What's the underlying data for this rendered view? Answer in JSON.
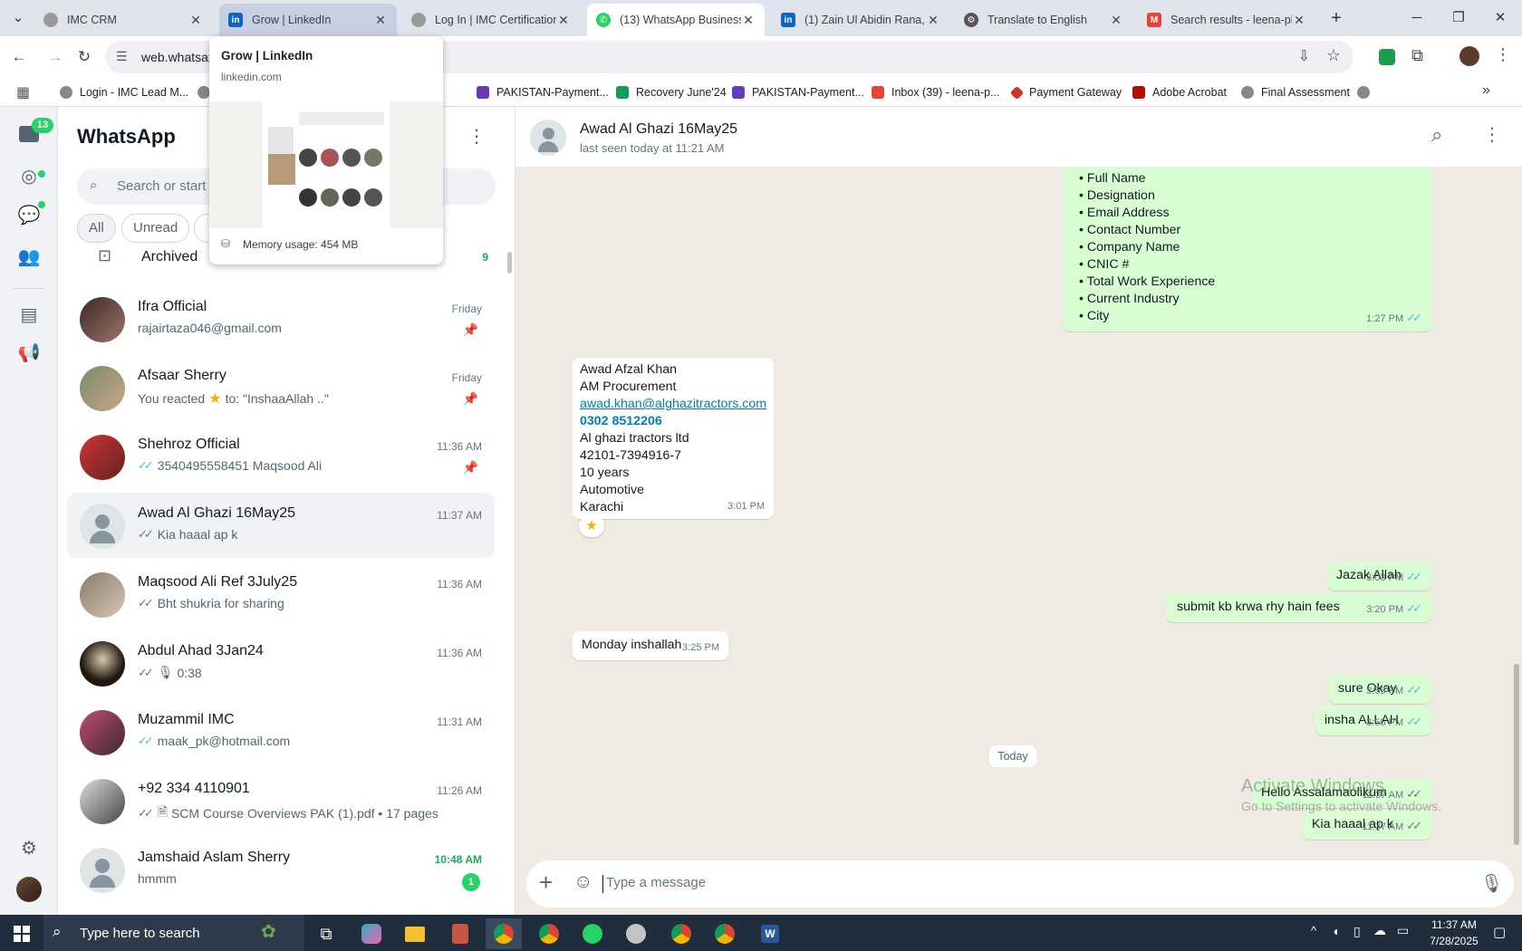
{
  "tabs": [
    {
      "label": "IMC CRM"
    },
    {
      "label": "Grow | LinkedIn"
    },
    {
      "label": "Log In | IMC Certification"
    },
    {
      "label": "(13) WhatsApp Business"
    },
    {
      "label": "(1) Zain Ul Abidin Rana, F"
    },
    {
      "label": "Translate to English"
    },
    {
      "label": "Search results - leena-pk"
    }
  ],
  "address": {
    "url": "web.whatsap"
  },
  "bookmarks": [
    {
      "label": "Login - IMC Lead M..."
    },
    {
      "label": "PAKISTAN-Payment..."
    },
    {
      "label": "Recovery June'24"
    },
    {
      "label": "PAKISTAN-Payment..."
    },
    {
      "label": "Inbox (39) - leena-p..."
    },
    {
      "label": "Payment Gateway"
    },
    {
      "label": "Adobe Acrobat"
    },
    {
      "label": "Final Assessment"
    }
  ],
  "hovercard": {
    "title": "Grow | LinkedIn",
    "domain": "linkedin.com",
    "memory": "Memory usage: 454 MB"
  },
  "rail": {
    "chats_badge": "13"
  },
  "sidebar": {
    "title": "WhatsApp",
    "search_placeholder": "Search or start",
    "filters": [
      "All",
      "Unread"
    ],
    "archived_label": "Archived",
    "archived_count": "9"
  },
  "chats": [
    {
      "name": "Ifra Official",
      "preview": "rajairtaza046@gmail.com",
      "time": "Friday"
    },
    {
      "name": "Afsaar Sherry",
      "preview": "You reacted",
      "preview2": "to: \"InshaaAllah ..\"",
      "time": "Friday"
    },
    {
      "name": "Shehroz Official",
      "preview": "3540495558451 Maqsood Ali",
      "time": "11:36 AM"
    },
    {
      "name": "Awad Al Ghazi 16May25",
      "preview": "Kia haaal ap k",
      "time": "11:37 AM"
    },
    {
      "name": "Maqsood Ali Ref 3July25",
      "preview": "Bht shukria for sharing",
      "time": "11:36 AM"
    },
    {
      "name": "Abdul Ahad 3Jan24",
      "preview": "0:38",
      "time": "11:36 AM"
    },
    {
      "name": "Muzammil IMC",
      "preview": "maak_pk@hotmail.com",
      "time": "11:31 AM"
    },
    {
      "name": "+92 334 4110901",
      "preview": "SCM Course Overviews PAK (1).pdf • 17 pages",
      "time": "11:26 AM"
    },
    {
      "name": "Jamshaid Aslam Sherry",
      "preview": "hmmm",
      "time": "10:48 AM",
      "unread": "1"
    }
  ],
  "chat_header": {
    "name": "Awad Al Ghazi 16May25",
    "status": "last seen today at 11:21 AM"
  },
  "messages": {
    "list_items": [
      "• Full Name",
      "• Designation",
      "• Email Address",
      "• Contact Number",
      "• Company Name",
      "• CNIC #",
      "• Total Work Experience",
      "• Current Industry",
      "• City"
    ],
    "list_time": "1:27 PM",
    "card_lines": [
      "Awad Afzal Khan",
      "AM Procurement"
    ],
    "card_email": "awad.khan@alghazitractors.com",
    "card_phone": "0302 8512206",
    "card_lines2": [
      "Al ghazi tractors ltd",
      "42101-7394916-7",
      "10 years",
      "Automotive",
      "Karachi"
    ],
    "card_time": "3:01 PM",
    "m1": {
      "text": "Jazak Allah",
      "time": "3:03 PM"
    },
    "m2": {
      "text": "submit kb krwa rhy hain fees",
      "time": "3:20 PM"
    },
    "m3": {
      "text": "Monday inshallah",
      "time": "3:25 PM"
    },
    "m4": {
      "text": "sure Okay",
      "time": "3:55 PM"
    },
    "m5": {
      "text": "insha ALLAH",
      "time": "3:55 PM"
    },
    "day": "Today",
    "m6": {
      "text": "Hello Assalamaolikum",
      "time": "11:37 AM"
    },
    "m7": {
      "text": "Kia haaal ap k",
      "time": "11:37 AM"
    }
  },
  "watermark": {
    "line1": "Activate Windows",
    "line2": "Go to Settings to activate Windows."
  },
  "composer": {
    "placeholder": "Type a message"
  },
  "taskbar": {
    "search": "Type here to search",
    "time": "11:37 AM",
    "date": "7/28/2025"
  }
}
